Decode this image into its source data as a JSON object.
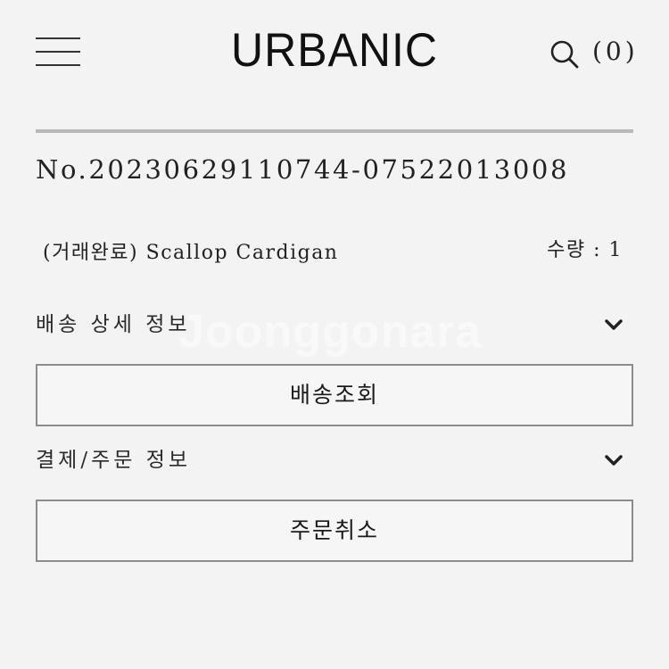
{
  "header": {
    "brand": "URBANIC",
    "cart_count": "(0)"
  },
  "order": {
    "number": "No.20230629110744-07522013008",
    "product_name": "(거래완료) Scallop Cardigan",
    "quantity_label": "수량 : 1"
  },
  "sections": {
    "shipping_details_title": "배송 상세 정보",
    "track_shipping_button": "배송조회",
    "payment_order_title": "결제/주문 정보",
    "cancel_order_button": "주문취소"
  },
  "watermark": "Joonggonara",
  "icons": {
    "menu": "hamburger-menu-icon",
    "search": "search-icon",
    "chevron": "chevron-down-icon"
  }
}
